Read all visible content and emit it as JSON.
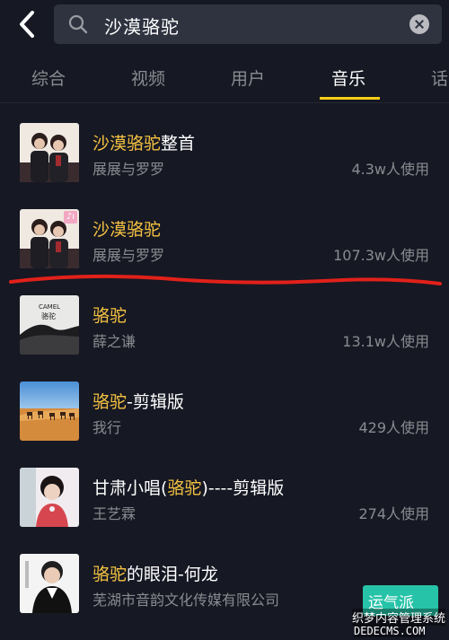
{
  "search": {
    "query": "沙漠骆驼"
  },
  "tabs": [
    {
      "label": "综合"
    },
    {
      "label": "视频"
    },
    {
      "label": "用户"
    },
    {
      "label": "音乐"
    },
    {
      "label": "话"
    }
  ],
  "active_tab_index": 3,
  "colors": {
    "background": "#161823",
    "search_field": "#2f3340",
    "accent_yellow": "#face15",
    "highlight_text": "#f5c242",
    "annotation_red": "#e1211a",
    "secondary_text": "#8a8b91"
  },
  "results": [
    {
      "title_hl": "沙漠骆驼",
      "title_rest": "整首",
      "artist": "展展与罗罗",
      "usage": "4.3w人使用"
    },
    {
      "title_hl": "沙漠骆驼",
      "title_rest": "",
      "artist": "展展与罗罗",
      "usage": "107.3w人使用"
    },
    {
      "title_hl": "骆驼",
      "title_rest": "",
      "artist": "薛之谦",
      "usage": "13.1w人使用",
      "cover_text_1": "CAMEL",
      "cover_text_2": "骆驼"
    },
    {
      "title_hl": "骆驼",
      "title_rest": "-剪辑版",
      "artist": "我行",
      "usage": "429人使用"
    },
    {
      "title_pre": "甘肃小唱(",
      "title_hl": "骆驼",
      "title_rest": ")----剪辑版",
      "artist": "王艺霖",
      "usage": "274人使用"
    },
    {
      "title_hl": "骆驼",
      "title_rest": "的眼泪-何龙",
      "artist": "芜湖市音韵文化传媒有限公司",
      "usage": ""
    }
  ],
  "watermark": {
    "green_text": "运气派",
    "line1": "织梦内容管理系统",
    "line2": "DEDECMS.COM"
  }
}
